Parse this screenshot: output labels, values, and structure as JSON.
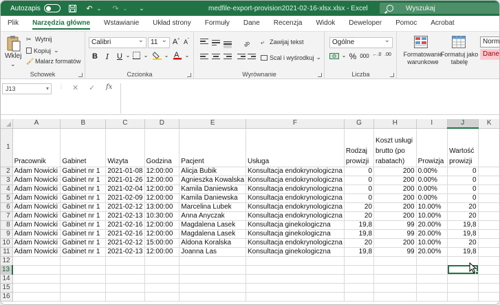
{
  "titlebar": {
    "autosave_label": "Autozapis",
    "document_title": "medfile-export-provision2021-02-16-xlsx.xlsx  -  Excel",
    "search_placeholder": "Wyszukaj"
  },
  "ribbon_tabs": [
    "Plik",
    "Narzędzia główne",
    "Wstawianie",
    "Układ strony",
    "Formuły",
    "Dane",
    "Recenzja",
    "Widok",
    "Deweloper",
    "Pomoc",
    "Acrobat"
  ],
  "active_tab": "Narzędzia główne",
  "ribbon": {
    "clipboard": {
      "paste": "Wklej",
      "cut": "Wytnij",
      "copy": "Kopiuj",
      "painter": "Malarz formatów",
      "label": "Schowek"
    },
    "font": {
      "name": "Calibri",
      "size": "11",
      "bold": "B",
      "italic": "I",
      "underline": "U",
      "grow": "A",
      "shrink": "A",
      "label": "Czcionka"
    },
    "alignment": {
      "wrap": "Zawijaj tekst",
      "merge": "Scal i wyśrodkuj",
      "label": "Wyrównanie"
    },
    "number": {
      "format": "Ogólne",
      "percent": "%",
      "thousands": "000",
      "label": "Liczba"
    },
    "styles": {
      "conditional": "Formatowanie warunkowe",
      "as_table": "Formatuj jako tabelę",
      "normal": "Norma",
      "bad": "Dane"
    }
  },
  "formula_bar": {
    "name_box": "J13",
    "value": ""
  },
  "columns": [
    "A",
    "B",
    "C",
    "D",
    "E",
    "F",
    "G",
    "H",
    "I",
    "J",
    "K"
  ],
  "selected_column": "J",
  "selected_row": 13,
  "header_row": {
    "A": "Pracownik",
    "B": "Gabinet",
    "C": "Wizyta",
    "D": "Godzina",
    "E": "Pacjent",
    "F": "Usługa",
    "G": "Rodzaj prowizji",
    "H": "Koszt usługi brutto (po rabatach)",
    "I": "Prowizja",
    "J": "Wartość prowizji"
  },
  "rows": [
    {
      "A": "Adam Nowicki",
      "B": "Gabinet nr 1",
      "C": "2021-01-08",
      "D": "12:00:00",
      "E": "Alicja Bubik",
      "F": "Konsultacja endokrynologiczna",
      "G": "0",
      "H": "200",
      "I": "0.00%",
      "J": "0"
    },
    {
      "A": "Adam Nowicki",
      "B": "Gabinet nr 1",
      "C": "2021-01-26",
      "D": "12:00:00",
      "E": "Agnieszka Kowalska",
      "F": "Konsultacja endokrynologiczna",
      "G": "0",
      "H": "200",
      "I": "0.00%",
      "J": "0"
    },
    {
      "A": "Adam Nowicki",
      "B": "Gabinet nr 1",
      "C": "2021-02-04",
      "D": "12:00:00",
      "E": "Kamila Daniewska",
      "F": "Konsultacja endokrynologiczna",
      "G": "0",
      "H": "200",
      "I": "0.00%",
      "J": "0"
    },
    {
      "A": "Adam Nowicki",
      "B": "Gabinet nr 1",
      "C": "2021-02-09",
      "D": "12:00:00",
      "E": "Kamila Daniewska",
      "F": "Konsultacja endokrynologiczna",
      "G": "0",
      "H": "200",
      "I": "0.00%",
      "J": "0"
    },
    {
      "A": "Adam Nowicki",
      "B": "Gabinet nr 1",
      "C": "2021-02-12",
      "D": "13:00:00",
      "E": "Marcelina Lubek",
      "F": "Konsultacja endokrynologiczna",
      "G": "20",
      "H": "200",
      "I": "10.00%",
      "J": "20"
    },
    {
      "A": "Adam Nowicki",
      "B": "Gabinet nr 1",
      "C": "2021-02-13",
      "D": "10:30:00",
      "E": "Anna Anyczak",
      "F": "Konsultacja endokrynologiczna",
      "G": "20",
      "H": "200",
      "I": "10.00%",
      "J": "20"
    },
    {
      "A": "Adam Nowicki",
      "B": "Gabinet nr 1",
      "C": "2021-02-16",
      "D": "12:00:00",
      "E": "Magdalena Lasek",
      "F": "Konsultacja ginekologiczna",
      "G": "19,8",
      "H": "99",
      "I": "20.00%",
      "J": "19,8"
    },
    {
      "A": "Adam Nowicki",
      "B": "Gabinet nr 1",
      "C": "2021-02-16",
      "D": "12:00:00",
      "E": "Magdalena Lasek",
      "F": "Konsultacja ginekologiczna",
      "G": "19,8",
      "H": "99",
      "I": "20.00%",
      "J": "19,8"
    },
    {
      "A": "Adam Nowicki",
      "B": "Gabinet nr 1",
      "C": "2021-02-12",
      "D": "15:00:00",
      "E": "Aldona Koralska",
      "F": "Konsultacja endokrynologiczna",
      "G": "20",
      "H": "200",
      "I": "10.00%",
      "J": "20"
    },
    {
      "A": "Adam Nowicki",
      "B": "Gabinet nr 1",
      "C": "2021-02-13",
      "D": "12:00:00",
      "E": "Joanna Las",
      "F": "Konsultacja ginekologiczna",
      "G": "19,8",
      "H": "99",
      "I": "20.00%",
      "J": "19,8"
    }
  ],
  "empty_row_numbers": [
    12,
    13,
    14,
    15,
    16
  ],
  "colors": {
    "excel_green": "#217346",
    "header_gray": "#efefef"
  }
}
